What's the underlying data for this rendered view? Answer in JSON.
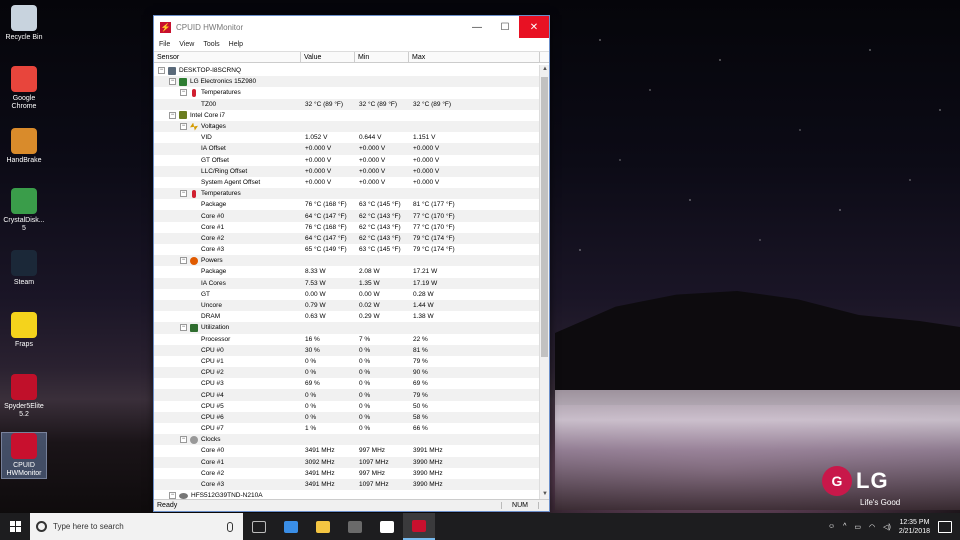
{
  "desktop": {
    "icons": [
      {
        "label": "Recycle Bin",
        "color": "#c8d3de"
      },
      {
        "label": "Google Chrome",
        "color": "#e8453c"
      },
      {
        "label": "HandBrake",
        "color": "#d98b2b"
      },
      {
        "label": "CrystalDisk... 5",
        "color": "#3a9d4a"
      },
      {
        "label": "Steam",
        "color": "#1b2838"
      },
      {
        "label": "Fraps",
        "color": "#f4d31c"
      },
      {
        "label": "Spyder5Elite 5.2",
        "color": "#c0102a"
      },
      {
        "label": "CPUID HWMonitor",
        "color": "#c8102e"
      }
    ],
    "brand": {
      "logo": "LG",
      "tagline": "Life's Good"
    }
  },
  "window": {
    "title": "CPUID HWMonitor",
    "menu": [
      "File",
      "View",
      "Tools",
      "Help"
    ],
    "columns": [
      "Sensor",
      "Value",
      "Min",
      "Max"
    ],
    "rows": [
      {
        "level": 0,
        "exp": "-",
        "icon": "pc",
        "name": "DESKTOP-I8SCRNQ",
        "v": "",
        "mn": "",
        "mx": ""
      },
      {
        "level": 1,
        "exp": "-",
        "icon": "mb",
        "name": "LG Electronics 15Z980",
        "v": "",
        "mn": "",
        "mx": ""
      },
      {
        "level": 2,
        "exp": "-",
        "icon": "therm",
        "name": "Temperatures",
        "v": "",
        "mn": "",
        "mx": ""
      },
      {
        "level": 3,
        "exp": "",
        "icon": "",
        "name": "TZ00",
        "v": "32 °C  (89 °F)",
        "mn": "32 °C  (89 °F)",
        "mx": "32 °C  (89 °F)"
      },
      {
        "level": 1,
        "exp": "-",
        "icon": "cpu",
        "name": "Intel Core i7",
        "v": "",
        "mn": "",
        "mx": ""
      },
      {
        "level": 2,
        "exp": "-",
        "icon": "volt",
        "name": "Voltages",
        "v": "",
        "mn": "",
        "mx": ""
      },
      {
        "level": 3,
        "exp": "",
        "icon": "",
        "name": "VID",
        "v": "1.052 V",
        "mn": "0.644 V",
        "mx": "1.151 V"
      },
      {
        "level": 3,
        "exp": "",
        "icon": "",
        "name": "IA Offset",
        "v": "+0.000 V",
        "mn": "+0.000 V",
        "mx": "+0.000 V"
      },
      {
        "level": 3,
        "exp": "",
        "icon": "",
        "name": "GT Offset",
        "v": "+0.000 V",
        "mn": "+0.000 V",
        "mx": "+0.000 V"
      },
      {
        "level": 3,
        "exp": "",
        "icon": "",
        "name": "LLC/Ring Offset",
        "v": "+0.000 V",
        "mn": "+0.000 V",
        "mx": "+0.000 V"
      },
      {
        "level": 3,
        "exp": "",
        "icon": "",
        "name": "System Agent Offset",
        "v": "+0.000 V",
        "mn": "+0.000 V",
        "mx": "+0.000 V"
      },
      {
        "level": 2,
        "exp": "-",
        "icon": "therm",
        "name": "Temperatures",
        "v": "",
        "mn": "",
        "mx": ""
      },
      {
        "level": 3,
        "exp": "",
        "icon": "",
        "name": "Package",
        "v": "76 °C  (168 °F)",
        "mn": "63 °C  (145 °F)",
        "mx": "81 °C  (177 °F)"
      },
      {
        "level": 3,
        "exp": "",
        "icon": "",
        "name": "Core #0",
        "v": "64 °C  (147 °F)",
        "mn": "62 °C  (143 °F)",
        "mx": "77 °C  (170 °F)"
      },
      {
        "level": 3,
        "exp": "",
        "icon": "",
        "name": "Core #1",
        "v": "76 °C  (168 °F)",
        "mn": "62 °C  (143 °F)",
        "mx": "77 °C  (170 °F)"
      },
      {
        "level": 3,
        "exp": "",
        "icon": "",
        "name": "Core #2",
        "v": "64 °C  (147 °F)",
        "mn": "62 °C  (143 °F)",
        "mx": "79 °C  (174 °F)"
      },
      {
        "level": 3,
        "exp": "",
        "icon": "",
        "name": "Core #3",
        "v": "65 °C  (149 °F)",
        "mn": "63 °C  (145 °F)",
        "mx": "79 °C  (174 °F)"
      },
      {
        "level": 2,
        "exp": "-",
        "icon": "pow",
        "name": "Powers",
        "v": "",
        "mn": "",
        "mx": ""
      },
      {
        "level": 3,
        "exp": "",
        "icon": "",
        "name": "Package",
        "v": "8.33 W",
        "mn": "2.08 W",
        "mx": "17.21 W"
      },
      {
        "level": 3,
        "exp": "",
        "icon": "",
        "name": "IA Cores",
        "v": "7.53 W",
        "mn": "1.35 W",
        "mx": "17.19 W"
      },
      {
        "level": 3,
        "exp": "",
        "icon": "",
        "name": "GT",
        "v": "0.00 W",
        "mn": "0.00 W",
        "mx": "0.28 W"
      },
      {
        "level": 3,
        "exp": "",
        "icon": "",
        "name": "Uncore",
        "v": "0.79 W",
        "mn": "0.02 W",
        "mx": "1.44 W"
      },
      {
        "level": 3,
        "exp": "",
        "icon": "",
        "name": "DRAM",
        "v": "0.63 W",
        "mn": "0.29 W",
        "mx": "1.38 W"
      },
      {
        "level": 2,
        "exp": "-",
        "icon": "util",
        "name": "Utilization",
        "v": "",
        "mn": "",
        "mx": ""
      },
      {
        "level": 3,
        "exp": "",
        "icon": "",
        "name": "Processor",
        "v": "16 %",
        "mn": "7 %",
        "mx": "22 %"
      },
      {
        "level": 3,
        "exp": "",
        "icon": "",
        "name": "CPU #0",
        "v": "30 %",
        "mn": "0 %",
        "mx": "81 %"
      },
      {
        "level": 3,
        "exp": "",
        "icon": "",
        "name": "CPU #1",
        "v": "0 %",
        "mn": "0 %",
        "mx": "79 %"
      },
      {
        "level": 3,
        "exp": "",
        "icon": "",
        "name": "CPU #2",
        "v": "0 %",
        "mn": "0 %",
        "mx": "90 %"
      },
      {
        "level": 3,
        "exp": "",
        "icon": "",
        "name": "CPU #3",
        "v": "69 %",
        "mn": "0 %",
        "mx": "69 %"
      },
      {
        "level": 3,
        "exp": "",
        "icon": "",
        "name": "CPU #4",
        "v": "0 %",
        "mn": "0 %",
        "mx": "79 %"
      },
      {
        "level": 3,
        "exp": "",
        "icon": "",
        "name": "CPU #5",
        "v": "0 %",
        "mn": "0 %",
        "mx": "50 %"
      },
      {
        "level": 3,
        "exp": "",
        "icon": "",
        "name": "CPU #6",
        "v": "0 %",
        "mn": "0 %",
        "mx": "58 %"
      },
      {
        "level": 3,
        "exp": "",
        "icon": "",
        "name": "CPU #7",
        "v": "1 %",
        "mn": "0 %",
        "mx": "66 %"
      },
      {
        "level": 2,
        "exp": "-",
        "icon": "clk",
        "name": "Clocks",
        "v": "",
        "mn": "",
        "mx": ""
      },
      {
        "level": 3,
        "exp": "",
        "icon": "",
        "name": "Core #0",
        "v": "3491 MHz",
        "mn": "997 MHz",
        "mx": "3991 MHz"
      },
      {
        "level": 3,
        "exp": "",
        "icon": "",
        "name": "Core #1",
        "v": "3092 MHz",
        "mn": "1097 MHz",
        "mx": "3990 MHz"
      },
      {
        "level": 3,
        "exp": "",
        "icon": "",
        "name": "Core #2",
        "v": "3491 MHz",
        "mn": "997 MHz",
        "mx": "3990 MHz"
      },
      {
        "level": 3,
        "exp": "",
        "icon": "",
        "name": "Core #3",
        "v": "3491 MHz",
        "mn": "1097 MHz",
        "mx": "3990 MHz"
      },
      {
        "level": 1,
        "exp": "-",
        "icon": "hdd",
        "name": "HFS512G39TND-N210A",
        "v": "",
        "mn": "",
        "mx": ""
      }
    ],
    "status": {
      "left": "Ready",
      "num": "NUM"
    }
  },
  "taskbar": {
    "search_placeholder": "Type here to search",
    "apps": [
      {
        "name": "task-view",
        "color": "#bbbbbb"
      },
      {
        "name": "edge",
        "color": "#3a8ee6"
      },
      {
        "name": "file-explorer",
        "color": "#f4c542"
      },
      {
        "name": "store",
        "color": "#6a6a6a"
      },
      {
        "name": "mail",
        "color": "#ffffff"
      },
      {
        "name": "hwmonitor",
        "color": "#c8102e"
      }
    ],
    "time": "12:35 PM",
    "date": "2/21/2018"
  }
}
